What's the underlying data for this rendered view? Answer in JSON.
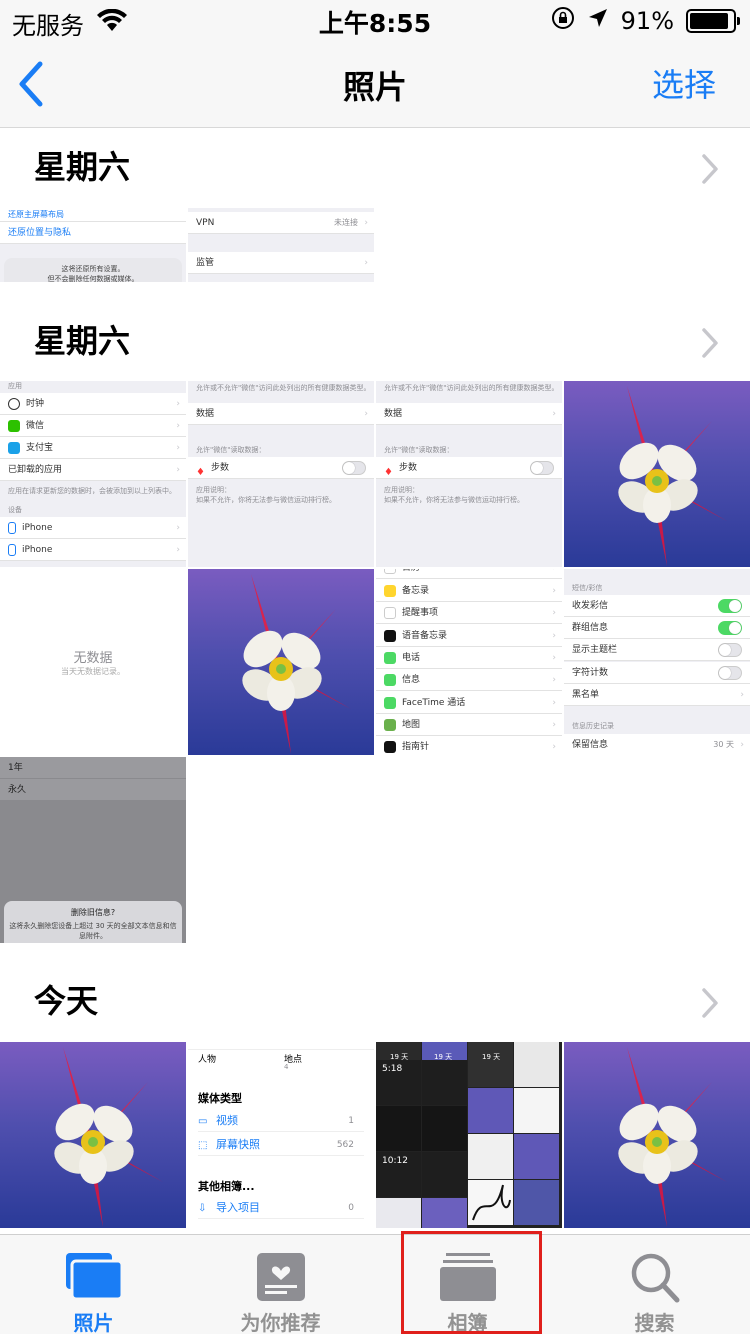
{
  "status_bar": {
    "carrier": "无服务",
    "time": "上午8:55",
    "battery_percent": "91%",
    "battery_level": 0.91
  },
  "nav": {
    "title": "照片",
    "select_label": "选择",
    "accent_color": "#1a7df5"
  },
  "sections": [
    {
      "title": "星期六"
    },
    {
      "title": "星期六"
    },
    {
      "title": "今天"
    }
  ],
  "thumbs": {
    "s1_a": {
      "line1": "还原主屏幕布局",
      "line2": "还原位置与隐私",
      "alert1": "这将还原所有设置。",
      "alert2": "但不会删除任何数据或媒体。"
    },
    "s1_b": {
      "vpn": "VPN",
      "vpn_value": "未连接",
      "supervise": "监管"
    },
    "s2_settings": {
      "cap_app": "应用",
      "clock": "时钟",
      "wechat": "微信",
      "alipay": "支付宝",
      "uninstalled": "已卸载的应用",
      "cap_note": "应用在请求更新您的数据时，会被添加到以上列表中。",
      "cap_device": "设备",
      "iphone1": "iPhone",
      "iphone2": "iPhone"
    },
    "s2_health": {
      "cap_top": "允许或不允许\"微信\"访问此处列出的所有健康数据类型。",
      "data": "数据",
      "cap_read": "允许\"微信\"读取数据：",
      "steps": "步数",
      "cap_explain": "应用说明：",
      "explain": "如果不允许，你将无法参与微信运动排行榜。"
    },
    "s2_nodata": {
      "big": "无数据",
      "small": "当天无数据记录。"
    },
    "s2_apps": {
      "calendar": "日历",
      "notes": "备忘录",
      "reminders": "提醒事项",
      "voice": "语音备忘录",
      "phone": "电话",
      "messages": "信息",
      "facetime": "FaceTime 通话",
      "maps": "地图",
      "compass": "指南针"
    },
    "s2_msg": {
      "cap_sms": "短信/彩信",
      "mms": "收发彩信",
      "group": "群组信息",
      "subject": "显示主题栏",
      "count": "字符计数",
      "blacklist": "黑名单",
      "cap_history": "信息历史记录",
      "keep": "保留信息",
      "keep_value": "30 天"
    },
    "s2_delete": {
      "year": "1年",
      "forever": "永久",
      "alert_title": "删除旧信息?",
      "alert_body": "这将永久删除您设备上超过 30 天的全部文本信息和信息附件。"
    },
    "s3_album": {
      "people": "人物",
      "places": "地点",
      "places_count": "4",
      "media_types": "媒体类型",
      "videos": "视频",
      "videos_count": "1",
      "screenshots": "屏幕快照",
      "screenshots_count": "562",
      "other_albums": "其他相簿...",
      "imports": "导入项目",
      "imports_count": "0"
    },
    "s3_grid": {
      "d1": "19 天",
      "d2": "19 天",
      "d3": "19 天",
      "t1": "5:18",
      "t2": "10:12"
    }
  },
  "tabbar": {
    "tabs": [
      {
        "label": "照片",
        "icon": "photos-icon",
        "active": true
      },
      {
        "label": "为你推荐",
        "icon": "for-you-icon",
        "active": false
      },
      {
        "label": "相簿",
        "icon": "albums-icon",
        "active": false
      },
      {
        "label": "搜索",
        "icon": "search-icon",
        "active": false
      }
    ],
    "active_color": "#1a7df5",
    "inactive_color": "#929292",
    "highlight_color": "#e0201c"
  }
}
